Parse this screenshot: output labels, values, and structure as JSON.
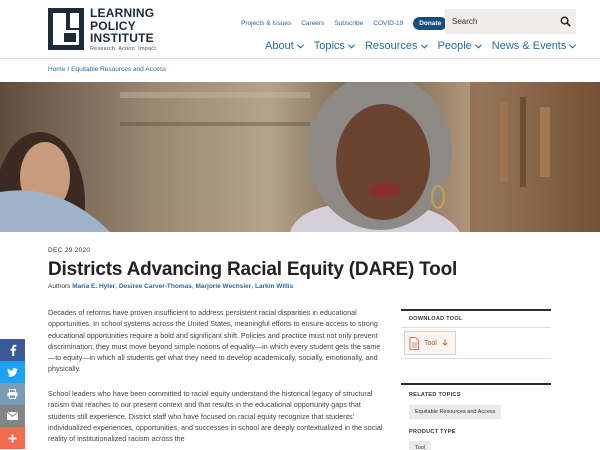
{
  "logo": {
    "line1": "LEARNING",
    "line2": "POLICY",
    "line3": "INSTITUTE",
    "tagline": "Research. Action. Impact."
  },
  "utility_nav": {
    "items": [
      "Projects & Issues",
      "Careers",
      "Subscribe",
      "COVID-19"
    ],
    "donate_label": "Donate"
  },
  "search": {
    "placeholder": "Search"
  },
  "main_nav": {
    "items": [
      "About",
      "Topics",
      "Resources",
      "People",
      "News & Events"
    ]
  },
  "breadcrumb": {
    "home": "Home",
    "current": "Equitable Resources and Access",
    "separator": "/"
  },
  "article": {
    "date": "DEC 29 2020",
    "title": "Districts Advancing Racial Equity (DARE) Tool",
    "authors_label": "Authors",
    "authors": [
      "Maria E. Hyler",
      "Desiree Carver-Thomas",
      "Marjorie Wechsler",
      "Larkin Willis"
    ],
    "paragraph1": "Decades of reforms have proven insufficient to address persistent racial disparities in educational opportunities. In school systems across the United States, meaningful efforts to ensure access to strong educational opportunities require a bold and significant shift. Policies and practice must not only prevent discrimination; they must move beyond simple notions of equality—in which every student gets the same—to equity—in which all students get what they need to develop academically, socially, emotionally, and physically.",
    "paragraph2": "School leaders who have been committed to racial equity understand the historical legacy of structural racism that reaches to our present context and that results in the educational opportunity gaps that students still experience. District staff who have focused on racial equity recognize that students' individualized experiences, opportunities, and successes in school are deeply contextualized in the social reality of institutionalized racism across the"
  },
  "sidebar": {
    "download_heading": "DOWNLOAD TOOL",
    "tool_label": "Tool",
    "related_heading": "RELATED TOPICS",
    "related_topic": "Equitable Resources and Access",
    "product_heading": "PRODUCT TYPE",
    "product_type": "Tool"
  },
  "share": {
    "buttons": [
      {
        "icon": "facebook-icon",
        "color": "#3b5998"
      },
      {
        "icon": "twitter-icon",
        "color": "#1da1f2"
      },
      {
        "icon": "print-icon",
        "color": "#7b9cb8"
      },
      {
        "icon": "email-icon",
        "color": "#848484"
      },
      {
        "icon": "plus-icon",
        "color": "#f26c4f"
      }
    ]
  },
  "colors": {
    "link": "#2b6a9e",
    "brand_dark": "#1c2b3a",
    "donate": "#1c4e7a",
    "tool_accent": "#c0522f"
  }
}
